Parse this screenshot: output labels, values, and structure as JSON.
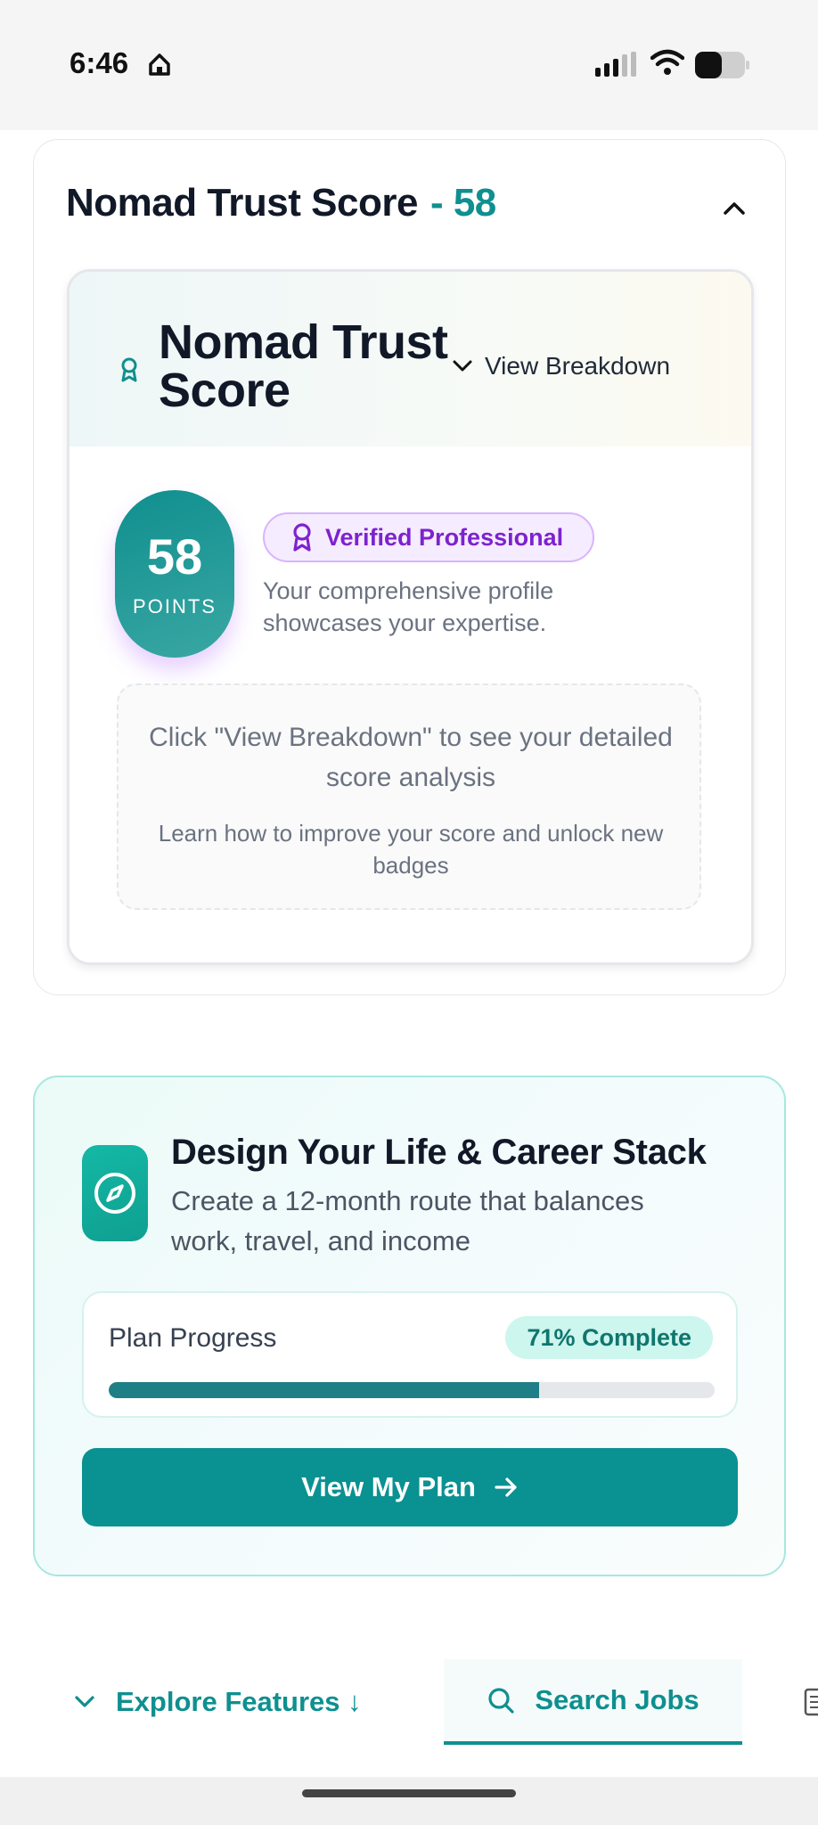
{
  "status_bar": {
    "time": "6:46",
    "icons": [
      "home-icon",
      "signal-icon",
      "wifi-icon",
      "battery-icon"
    ]
  },
  "trust_score_card": {
    "title": "Nomad Trust Score",
    "score_suffix": "- 58",
    "collapse_icon": "chevron-up-icon",
    "panel": {
      "icon": "award-icon",
      "title": "Nomad Trust Score",
      "view_breakdown_label": "View Breakdown",
      "points_value": "58",
      "points_label": "POINTS",
      "badge_label": "Verified Professional",
      "description": "Your comprehensive profile showcases your expertise.",
      "hint_main": "Click \"View Breakdown\" to see your detailed score analysis",
      "hint_sub": "Learn how to improve your score and unlock new badges"
    }
  },
  "plan_card": {
    "icon": "compass-icon",
    "title": "Design Your Life & Career Stack",
    "subtitle": "Create a 12-month route that balances work, travel, and income",
    "progress_label": "Plan Progress",
    "progress_status": "71% Complete",
    "progress_fraction": 0.71,
    "button_label": "View My Plan",
    "button_icon": "arrow-right-icon"
  },
  "bottom_tabs": {
    "explore_label": "Explore Features ↓",
    "search_label": "Search Jobs",
    "active_tab": "Search Jobs"
  },
  "colors": {
    "accent": "#0f8f8f",
    "purple": "#7e22ce",
    "progress_fill": "#1e7f86"
  }
}
